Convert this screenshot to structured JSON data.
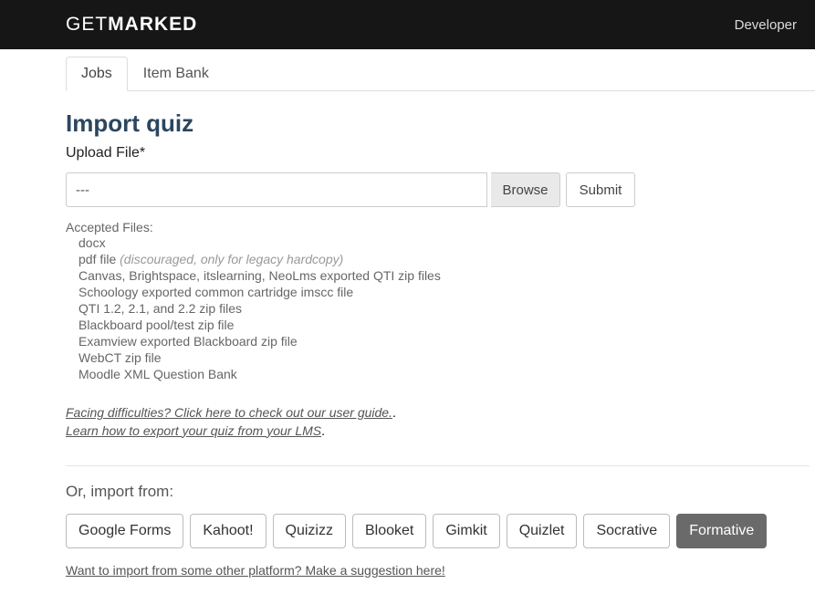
{
  "header": {
    "logo_get": "GET",
    "logo_marked": "MARKED",
    "developer": "Developer"
  },
  "tabs": {
    "jobs": "Jobs",
    "item_bank": "Item Bank"
  },
  "page": {
    "title": "Import quiz",
    "upload_label": "Upload File*",
    "file_value": "---",
    "browse": "Browse",
    "submit": "Submit"
  },
  "accepted": {
    "heading": "Accepted Files:",
    "items": [
      "docx",
      "pdf file ",
      "Canvas, Brightspace, itslearning, NeoLms exported QTI zip files",
      "Schoology exported common cartridge imscc file",
      "QTI 1.2, 2.1, and 2.2 zip files",
      "Blackboard pool/test zip file",
      "Examview exported Blackboard zip file",
      "WebCT zip file",
      "Moodle XML Question Bank"
    ],
    "pdf_note": "(discouraged, only for legacy hardcopy)"
  },
  "help": {
    "difficulties": "Facing difficulties? Click here to check out our user guide.",
    "export": "Learn how to export your quiz from your LMS"
  },
  "import_from": {
    "label": "Or, import from:",
    "platforms": [
      "Google Forms",
      "Kahoot!",
      "Quizizz",
      "Blooket",
      "Gimkit",
      "Quizlet",
      "Socrative",
      "Formative"
    ],
    "suggestion": "Want to import from some other platform? Make a suggestion here!"
  }
}
